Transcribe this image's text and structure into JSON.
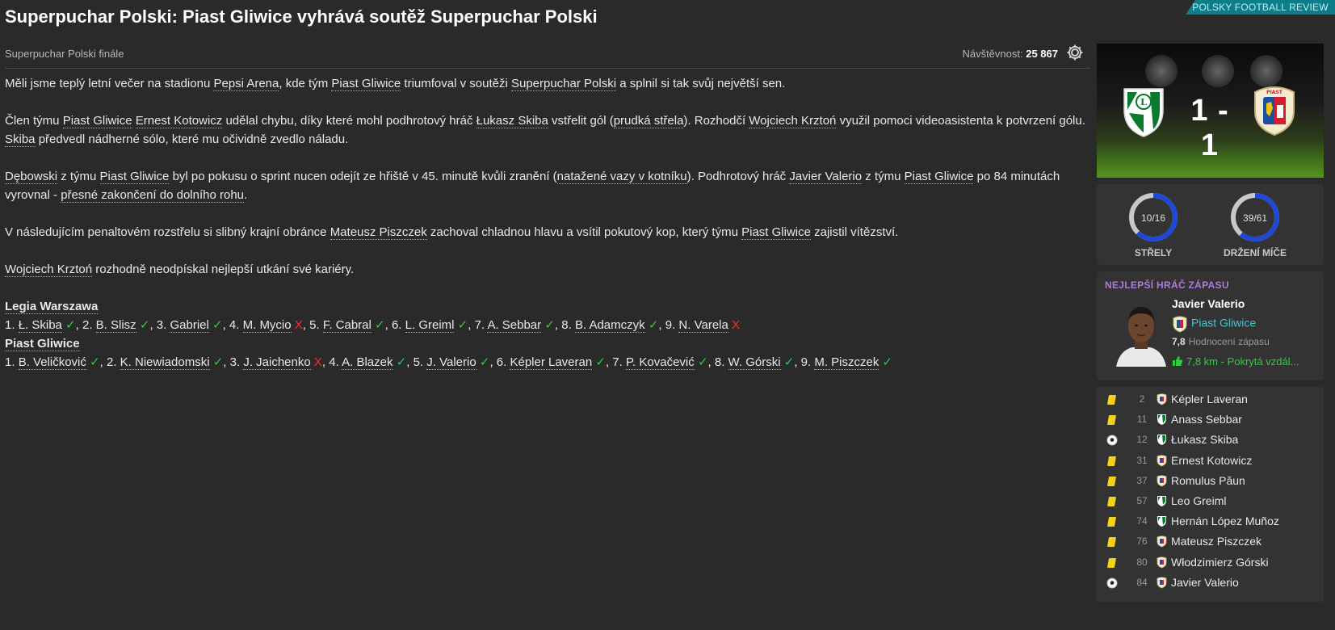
{
  "brand": "POLSKY FOOTBALL REVIEW",
  "headline": "Superpuchar Polski: Piast Gliwice vyhrává soutěž Superpuchar Polski",
  "competition_stage": "Superpuchar Polski finále",
  "attendance": {
    "label": "Návštěvnost:",
    "value": "25 867"
  },
  "icons": {
    "settings": "gear-icon",
    "goal": "ball-icon",
    "yellow_card": "yellow-card-icon",
    "thumbs": "thumbs-up-icon"
  },
  "colors": {
    "accent": "#0c7e8a",
    "potm_title": "#b27ad8",
    "club_link": "#3ec8d6",
    "good": "#2ecc40",
    "bad": "#ff2a2a",
    "ring": "#1f48d6"
  },
  "article": {
    "p1": {
      "t1": "Měli jsme teplý letní večer na stadionu ",
      "stadium": "Pepsi Arena",
      "t2": ", kde tým ",
      "team": "Piast Gliwice",
      "t3": " triumfoval v soutěži ",
      "comp": "Superpuchar Polski",
      "t4": " a splnil si tak svůj největší sen."
    },
    "p2": {
      "t1": "Člen týmu ",
      "team": "Piast Gliwice",
      "t2": " ",
      "player": "Ernest Kotowicz",
      "t3": " udělal chybu, díky které mohl podhrotový hráč ",
      "scorer": "Łukasz Skiba",
      "t4": " vstřelit gól (",
      "shot": "prudká střela",
      "t5": "). Rozhodčí ",
      "ref": "Wojciech Krztoń",
      "t6": " využil pomoci videoasistenta k potvrzení gólu. ",
      "scorer_short": "Skiba",
      "t7": " předvedl nádherné sólo, které mu očividně zvedlo náladu."
    },
    "p3": {
      "player": "Dębowski",
      "t1": " z týmu ",
      "team": "Piast Gliwice",
      "t2": " byl po pokusu o sprint nucen odejít ze hřiště v 45. minutě kvůli zranění (",
      "injury": "natažené vazy v kotníku",
      "t3": "). Podhrotový hráč ",
      "scorer": "Javier Valerio",
      "t4": " z týmu ",
      "team2": "Piast Gliwice",
      "t5": " po 84 minutách vyrovnal - ",
      "finish": "přesné zakončení do dolního rohu",
      "t6": "."
    },
    "p4": {
      "t1": "V následujícím penaltovém rozstřelu si slibný krajní obránce ",
      "player": "Mateusz Piszczek",
      "t2": " zachoval chladnou hlavu a vsítil pokutový kop, který týmu ",
      "team": "Piast Gliwice",
      "t3": " zajistil vítězství."
    },
    "p5": {
      "ref": "Wojciech Krztoń",
      "t1": " rozhodně neodpískal nejlepší utkání své kariéry."
    }
  },
  "shootout": [
    {
      "team": "Legia Warszawa",
      "kicks": [
        {
          "n": "1.",
          "name": "Ł. Skiba",
          "mark": "✓",
          "ok": true
        },
        {
          "n": "2.",
          "name": "B. Slisz",
          "mark": "✓",
          "ok": true
        },
        {
          "n": "3.",
          "name": "Gabriel",
          "mark": "✓",
          "ok": true
        },
        {
          "n": "4.",
          "name": "M. Mycio",
          "mark": "X",
          "ok": false
        },
        {
          "n": "5.",
          "name": "F. Cabral",
          "mark": "✓",
          "ok": true
        },
        {
          "n": "6.",
          "name": "L. Greiml",
          "mark": "✓",
          "ok": true
        },
        {
          "n": "7.",
          "name": "A. Sebbar",
          "mark": "✓",
          "ok": true
        },
        {
          "n": "8.",
          "name": "B. Adamczyk",
          "mark": "✓",
          "ok": true
        },
        {
          "n": "9.",
          "name": "N. Varela",
          "mark": "X",
          "ok": false
        }
      ]
    },
    {
      "team": "Piast Gliwice",
      "kicks": [
        {
          "n": "1.",
          "name": "B. Veličković",
          "mark": "✓",
          "ok": true
        },
        {
          "n": "2.",
          "name": "K. Niewiadomski",
          "mark": "✓",
          "ok": true
        },
        {
          "n": "3.",
          "name": "J. Jaichenko",
          "mark": "X",
          "ok": false
        },
        {
          "n": "4.",
          "name": "A. Blazek",
          "mark": "✓",
          "ok": true
        },
        {
          "n": "5.",
          "name": "J. Valerio",
          "mark": "✓",
          "ok": true
        },
        {
          "n": "6.",
          "name": "Képler Laveran",
          "mark": "✓",
          "ok": true
        },
        {
          "n": "7.",
          "name": "P. Kovačević",
          "mark": "✓",
          "ok": true
        },
        {
          "n": "8.",
          "name": "W. Górski",
          "mark": "✓",
          "ok": true
        },
        {
          "n": "9.",
          "name": "M. Piszczek",
          "mark": "✓",
          "ok": true
        }
      ]
    }
  ],
  "score": {
    "home": "1",
    "sep": "-",
    "away": "1"
  },
  "stats": [
    {
      "value": "10/16",
      "label": "STŘELY",
      "fraction": 0.625
    },
    {
      "value": "39/61",
      "label": "DRŽENÍ MÍČE",
      "fraction": 0.61
    }
  ],
  "potm": {
    "title": "NEJLEPŠÍ HRÁČ ZÁPASU",
    "name": "Javier Valerio",
    "club": "Piast Gliwice",
    "rating": "7,8",
    "rating_label": "Hodnocení zápasu",
    "distance": "7,8 km - Pokrytá vzdál..."
  },
  "events": [
    {
      "type": "yellow",
      "minute": "2",
      "team": "away",
      "player": "Képler Laveran"
    },
    {
      "type": "yellow",
      "minute": "11",
      "team": "home",
      "player": "Anass Sebbar"
    },
    {
      "type": "goal",
      "minute": "12",
      "team": "home",
      "player": "Łukasz Skiba"
    },
    {
      "type": "yellow",
      "minute": "31",
      "team": "away",
      "player": "Ernest Kotowicz"
    },
    {
      "type": "yellow",
      "minute": "37",
      "team": "away",
      "player": "Romulus Păun"
    },
    {
      "type": "yellow",
      "minute": "57",
      "team": "home",
      "player": "Leo Greiml"
    },
    {
      "type": "yellow",
      "minute": "74",
      "team": "home",
      "player": "Hernán López Muñoz"
    },
    {
      "type": "yellow",
      "minute": "76",
      "team": "away",
      "player": "Mateusz Piszczek"
    },
    {
      "type": "yellow",
      "minute": "80",
      "team": "away",
      "player": "Włodzimierz Górski"
    },
    {
      "type": "goal",
      "minute": "84",
      "team": "away",
      "player": "Javier Valerio"
    }
  ]
}
